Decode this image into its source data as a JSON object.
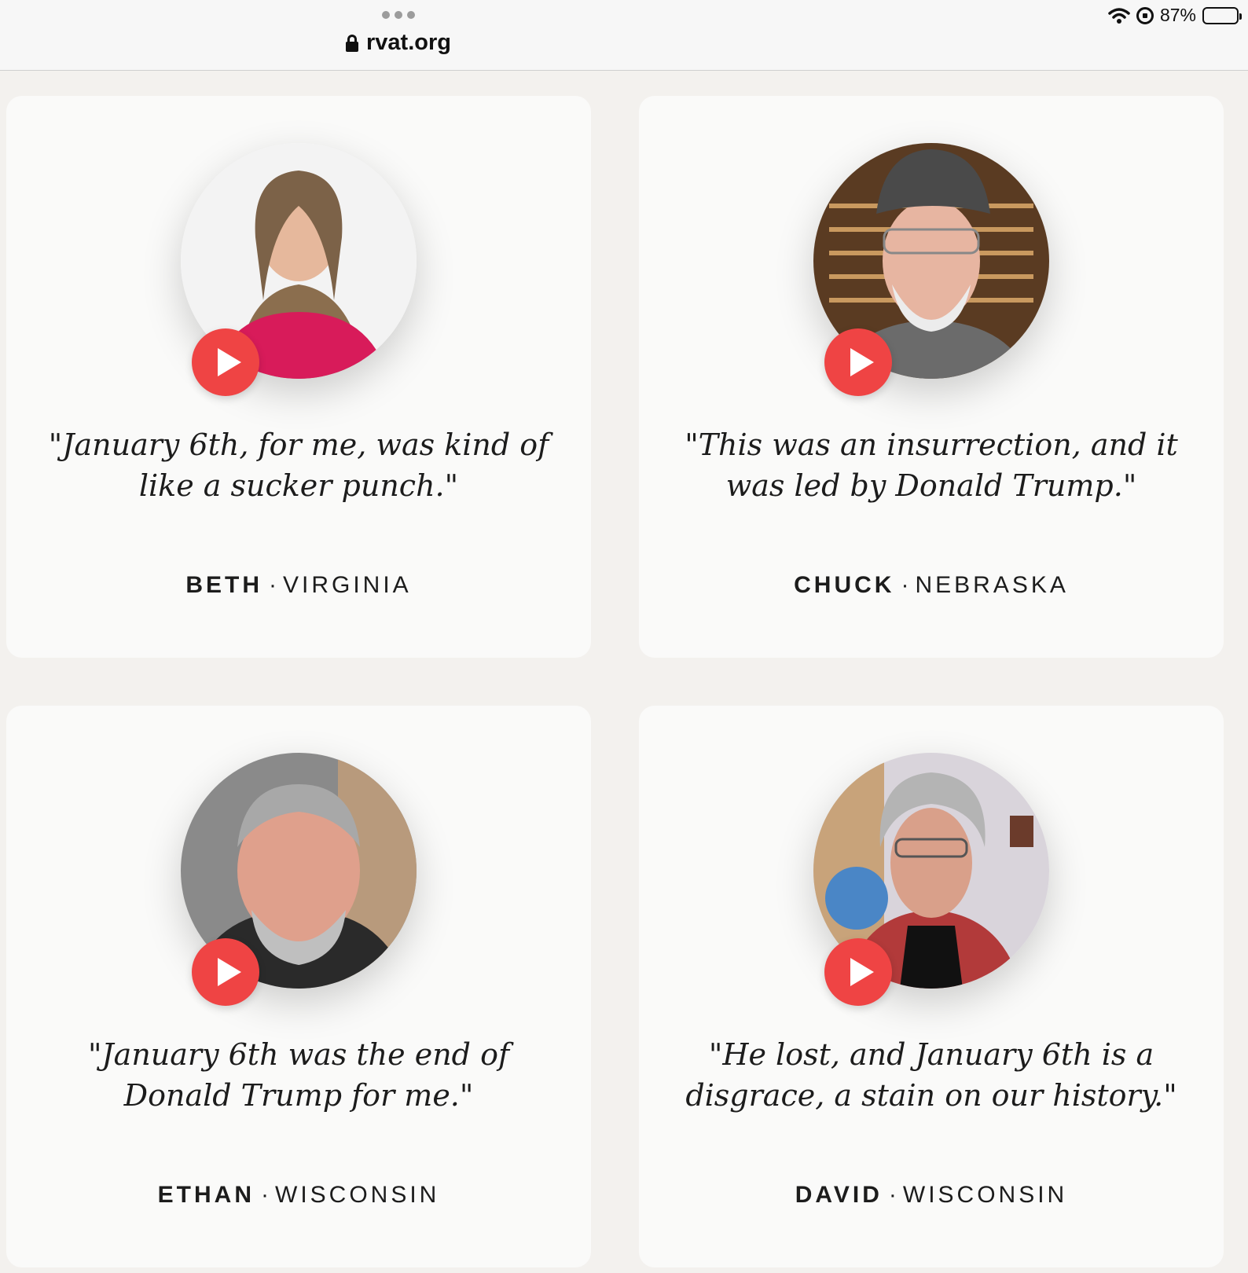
{
  "browser": {
    "url": "rvat.org",
    "battery": "87%"
  },
  "testimonials": [
    {
      "quote": "\"January 6th, for me, was kind of like a sucker punch.\"",
      "name": "BETH",
      "state": "VIRGINIA"
    },
    {
      "quote": "\"This was an insurrection, and it was led by Donald Trump.\"",
      "name": "CHUCK",
      "state": "NEBRASKA"
    },
    {
      "quote": "\"January 6th was the end of Donald Trump for me.\"",
      "name": "ETHAN",
      "state": "WISCONSIN"
    },
    {
      "quote": "\"He lost, and January 6th is a disgrace, a stain on our history.\"",
      "name": "DAVID",
      "state": "WISCONSIN"
    }
  ],
  "separator": "·",
  "colors": {
    "accent": "#ef4444",
    "background": "#f3f1ee",
    "card": "#fafaf9"
  }
}
